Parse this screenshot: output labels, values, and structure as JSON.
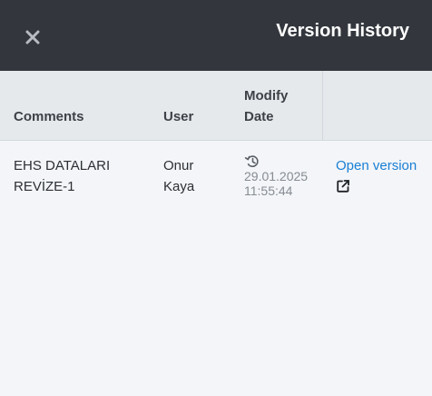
{
  "header": {
    "title": "Version History",
    "close_icon": "close-icon"
  },
  "table": {
    "columns": {
      "comments": "Comments",
      "user": "User",
      "modify_date": "Modify Date"
    },
    "rows": [
      {
        "comment": "EHS DATALARI REVİZE-1",
        "user": "Onur Kaya",
        "date": "29.01.2025 11:55:44",
        "date_icon": "history-icon",
        "action_label": "Open version",
        "action_icon": "external-link-icon"
      }
    ]
  },
  "colors": {
    "header_bg": "#33373d",
    "link": "#1a7fd4",
    "table_header_bg": "#e6e9ec",
    "panel_bg": "#f3f5f8"
  }
}
